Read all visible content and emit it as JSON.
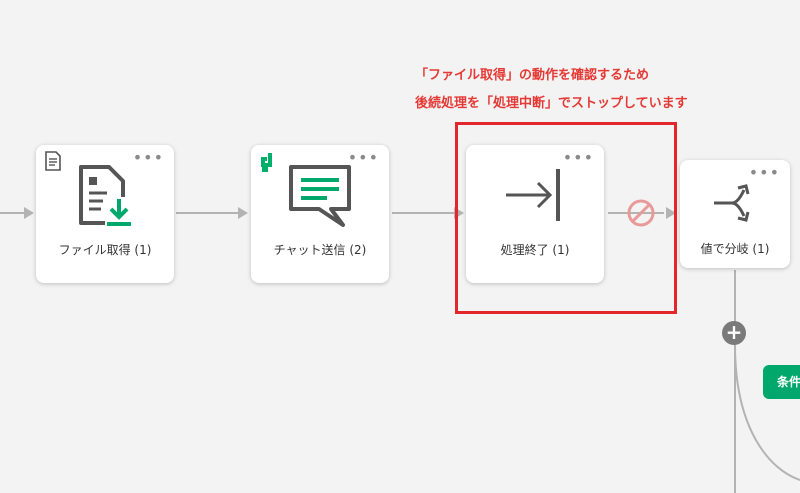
{
  "annotation": {
    "line1": "「ファイル取得」の動作を確認するため",
    "line2": "後続処理を「処理中断」でストップしています",
    "color": "#e53935"
  },
  "nodes": [
    {
      "id": "file-get",
      "label": "ファイル取得 (1)",
      "icon": "file-download-icon",
      "badge": "document-icon"
    },
    {
      "id": "chat-send",
      "label": "チャット送信 (2)",
      "icon": "chat-message-icon",
      "badge": "app-logo-icon"
    },
    {
      "id": "process-end",
      "label": "処理終了 (1)",
      "icon": "arrow-to-bar-icon"
    },
    {
      "id": "branch-by-value",
      "label": "値で分岐 (1)",
      "icon": "branch-split-icon"
    }
  ],
  "menu_glyph": "•••",
  "blocked_icon": "no-entry-icon",
  "add_button": {
    "glyph": "+"
  },
  "condition_tag": {
    "label": "条件"
  },
  "colors": {
    "accent_green": "#00a86b",
    "highlight_red": "#e3262b",
    "connector_gray": "#b3b3b3",
    "icon_gray": "#555555",
    "blocked_pink": "#e89a9a"
  }
}
